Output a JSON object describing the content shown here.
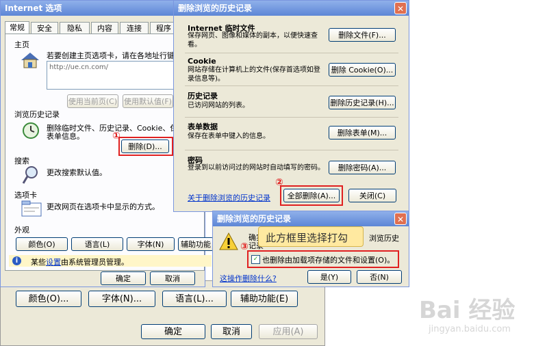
{
  "main_window": {
    "title": "Internet 选项",
    "tabs": [
      "常规",
      "安全",
      "隐私",
      "内容",
      "连接",
      "程序"
    ],
    "homepage": {
      "group": "主页",
      "desc": "若要创建主页选项卡，请在各地址行键入",
      "url": "http://ue.cn.com/",
      "use_current": "使用当前页(C)",
      "use_default": "使用默认值(F)"
    },
    "history": {
      "group": "浏览历史记录",
      "desc_line1": "删除临时文件、历史记录、Cookie、保存",
      "desc_line2": "表单信息。",
      "delete_button": "删除(D)..."
    },
    "search": {
      "group": "搜索",
      "desc": "更改搜索默认值。"
    },
    "tabs_section": {
      "group": "选项卡",
      "desc": "更改网页在选项卡中显示的方式。"
    },
    "appearance": {
      "group": "外观",
      "buttons": [
        "颜色(O)",
        "语言(L)",
        "字体(N)",
        "辅助功能"
      ]
    },
    "admin_notice": {
      "pre": "某些",
      "link": "设置",
      "post": "由系统管理员管理。"
    },
    "ok": "确定",
    "cancel": "取消"
  },
  "bottom_window": {
    "buttons": [
      "颜色(O)...",
      "字体(N)...",
      "语言(L)...",
      "辅助功能(E)"
    ],
    "ok": "确定",
    "cancel": "取消",
    "apply": "应用(A)"
  },
  "delete_history_dialog": {
    "title": "删除浏览的历史记录",
    "sections": [
      {
        "title": "Internet 临时文件",
        "desc": "保存网页、图像和媒体的副本，以便快速查看。",
        "button": "删除文件(F)..."
      },
      {
        "title": "Cookie",
        "desc": "网站存储在计算机上的文件(保存首选项如登录信息等)。",
        "button": "删除 Cookie(O)..."
      },
      {
        "title": "历史记录",
        "desc": "已访问网站的列表。",
        "button": "删除历史记录(H)..."
      },
      {
        "title": "表单数据",
        "desc": "保存在表单中键入的信息。",
        "button": "删除表单(M)..."
      },
      {
        "title": "密码",
        "desc": "登录到以前访问过的网站时自动填写的密码。",
        "button": "删除密码(A)..."
      }
    ],
    "about_link": "关于删除浏览的历史记录",
    "delete_all": "全部删除(A)...",
    "close": "关闭(C)"
  },
  "confirm_dialog": {
    "title": "删除浏览的历史记录",
    "text_left": "确实",
    "text_left2": "记录",
    "text_right": "浏览历史",
    "checkbox_label": "也删除由加载项存储的文件和设置(O)。",
    "link": "这操作删除什么?",
    "yes": "是(Y)",
    "no": "否(N)"
  },
  "annotation": {
    "text": "此方框里选择打勾",
    "n1": "①",
    "n2": "②",
    "n3": "③"
  },
  "watermark": {
    "brand": "Bai 经验",
    "url": "jingyan.baidu.com"
  },
  "colors": {
    "accent_red": "#e02020",
    "title_blue": "#5d86d6",
    "dialog_bg": "#ece9d8",
    "callout": "#ffe9a0"
  }
}
